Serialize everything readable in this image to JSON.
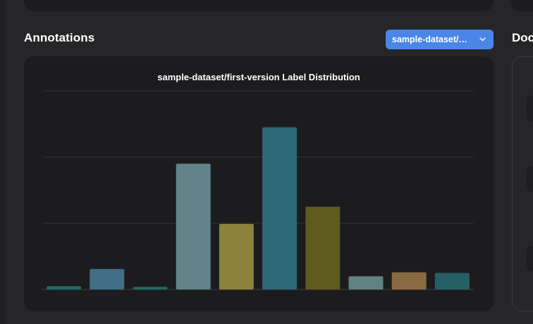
{
  "annotations": {
    "title": "Annotations",
    "dataset_select": {
      "value": "sample-dataset/…",
      "icon": "chevron-down-icon"
    }
  },
  "right_panel": {
    "title": "Doc"
  },
  "chart_data": {
    "type": "bar",
    "title": "sample-dataset/first-version Label Distribution",
    "xlabel": "",
    "ylabel": "",
    "ylim": [
      0,
      3
    ],
    "grid": true,
    "legend": "none",
    "series": [
      {
        "values": [
          0.05,
          0.31,
          0.04,
          1.9,
          0.99,
          2.45,
          1.25,
          0.2,
          0.26,
          0.25
        ],
        "colors": [
          "#1f6b65",
          "#3f6e85",
          "#1f6b65",
          "#5f8388",
          "#8b823c",
          "#2e6977",
          "#5f5a20",
          "#628184",
          "#8a6a42",
          "#275f67"
        ]
      }
    ]
  }
}
